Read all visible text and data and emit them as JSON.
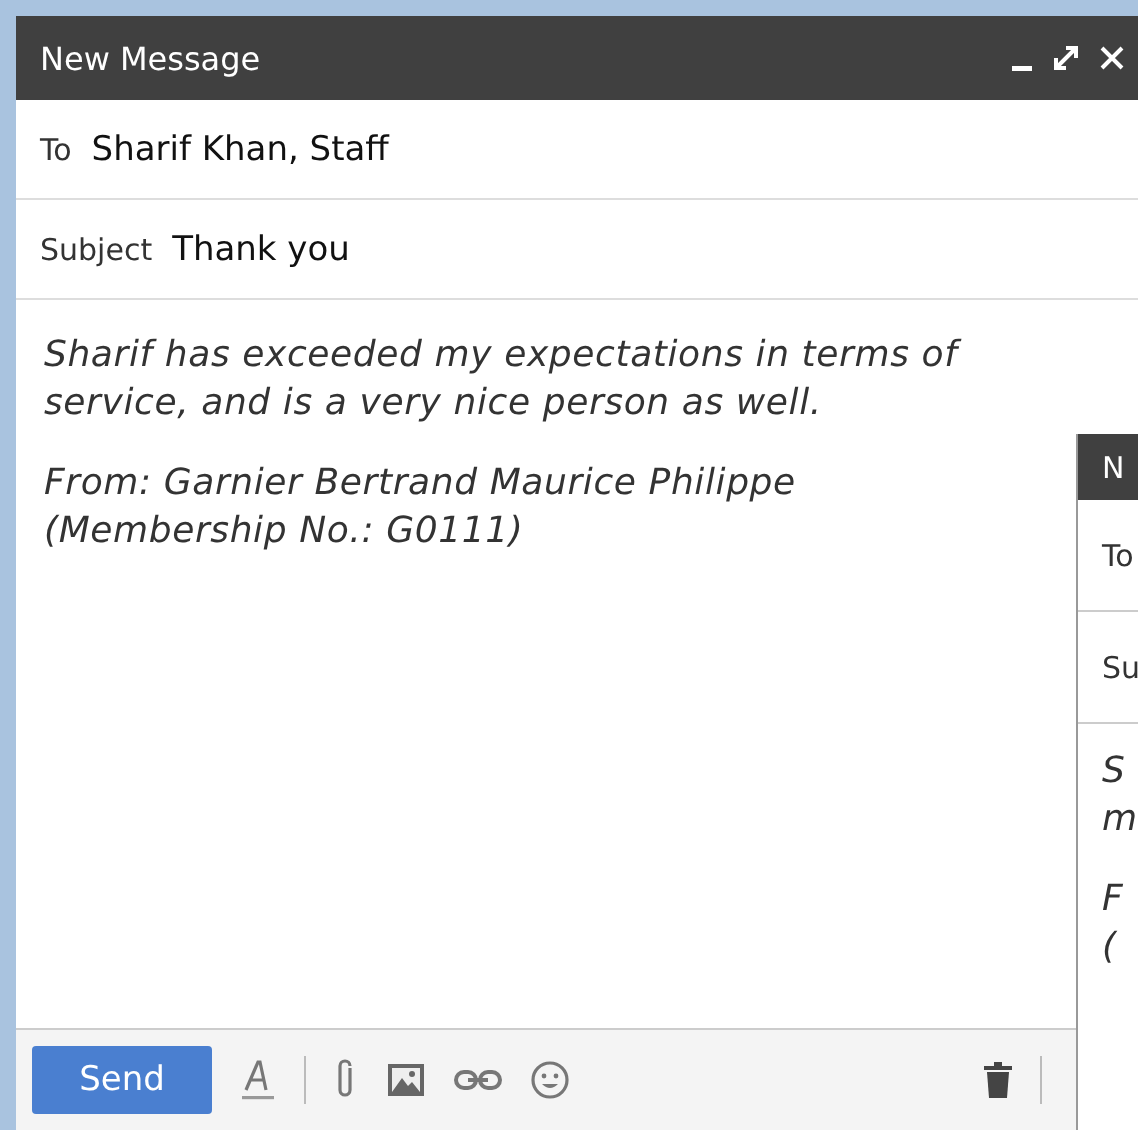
{
  "window": {
    "title": "New Message",
    "controls": [
      {
        "kind": "minimize"
      },
      {
        "kind": "expand"
      },
      {
        "kind": "close"
      }
    ]
  },
  "to": {
    "label": "To",
    "value": "Sharif Khan, Staff"
  },
  "subject": {
    "label": "Subject",
    "value": "Thank you"
  },
  "body": [
    "Sharif has exceeded my expectations in terms of\nservice, and is a very nice person as well.",
    "From: Garnier Bertrand Maurice Philippe\n(Membership No.: G0111)"
  ],
  "toolbar": {
    "send": "Send",
    "tools": [
      {
        "kind": "format"
      },
      {
        "kind": "divider"
      },
      {
        "kind": "attach"
      },
      {
        "kind": "photo"
      },
      {
        "kind": "link"
      },
      {
        "kind": "emoji"
      },
      {
        "kind": "trash"
      }
    ]
  },
  "second_window": {
    "title": "N",
    "to": "To",
    "subject": "Su",
    "body": [
      "S\nm",
      "F\n("
    ]
  }
}
